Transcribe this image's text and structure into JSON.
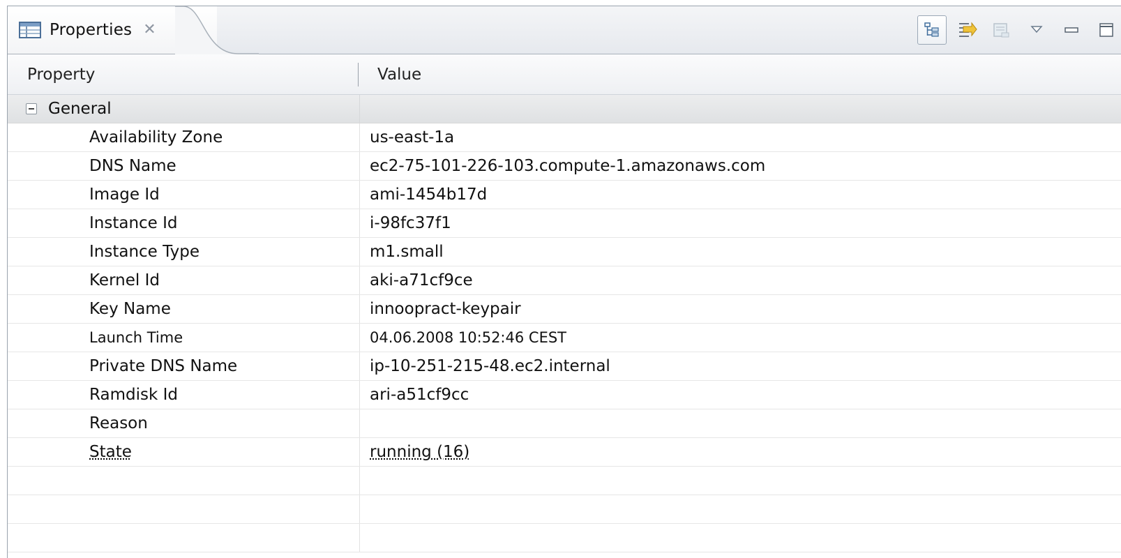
{
  "view": {
    "tab_title": "Properties",
    "tab_icon": "properties-view-icon",
    "close_icon": "close-tab-icon",
    "toolbar": [
      {
        "name": "show-categories-button",
        "icon": "tree-categories-icon",
        "pressed": true
      },
      {
        "name": "show-advanced-properties-button",
        "icon": "filter-advanced-icon",
        "pressed": false
      },
      {
        "name": "restore-default-value-button",
        "icon": "restore-default-icon",
        "pressed": false,
        "disabled": true
      },
      {
        "name": "view-menu-button",
        "icon": "chevron-down-icon"
      },
      {
        "name": "minimize-button",
        "icon": "minimize-icon"
      },
      {
        "name": "maximize-button",
        "icon": "maximize-icon"
      }
    ]
  },
  "table": {
    "columns": [
      "Property",
      "Value"
    ],
    "category": {
      "label": "General",
      "expanded": true
    },
    "rows": [
      {
        "property": "Availability Zone",
        "value": "us-east-1a"
      },
      {
        "property": "DNS Name",
        "value": "ec2-75-101-226-103.compute-1.amazonaws.com"
      },
      {
        "property": "Image Id",
        "value": "ami-1454b17d"
      },
      {
        "property": "Instance Id",
        "value": "i-98fc37f1"
      },
      {
        "property": "Instance Type",
        "value": "m1.small"
      },
      {
        "property": "Kernel Id",
        "value": "aki-a71cf9ce"
      },
      {
        "property": "Key Name",
        "value": "innoopract-keypair"
      },
      {
        "property": "Launch Time",
        "value": "04.06.2008 10:52:46 CEST"
      },
      {
        "property": "Private DNS Name",
        "value": "ip-10-251-215-48.ec2.internal"
      },
      {
        "property": "Ramdisk Id",
        "value": "ari-a51cf9cc"
      },
      {
        "property": "Reason",
        "value": ""
      },
      {
        "property": "State",
        "value": "running (16)"
      }
    ]
  },
  "colors": {
    "header_bg": "#eef0f3",
    "category_bg": "#e2e4e6",
    "grid_line": "#e2e2e2",
    "text": "#111111"
  }
}
